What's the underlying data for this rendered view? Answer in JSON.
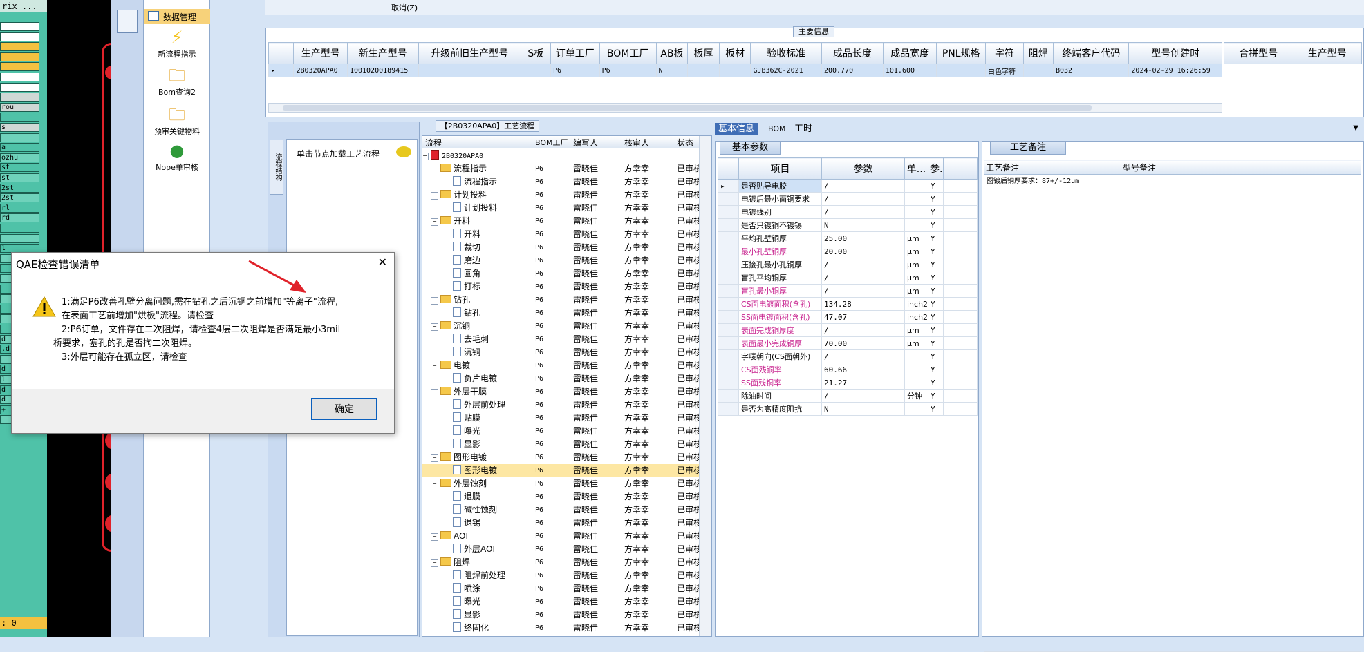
{
  "left_strip": {
    "title": "rix ...",
    "rows": [
      "",
      "",
      "",
      "",
      "",
      "",
      "",
      "",
      "rou",
      "",
      "s",
      "",
      "a",
      "ozhu",
      "st",
      "st",
      "2st",
      "2st",
      "rl",
      "rd",
      "",
      "",
      "l",
      "",
      "",
      "",
      "",
      "",
      "",
      "",
      "",
      "d",
      ".d",
      "",
      "d",
      "l",
      "d",
      "d",
      "+",
      ""
    ],
    "status": ": 0"
  },
  "nav": {
    "items": [
      {
        "label": "数据管理",
        "icon": "data-grid-icon"
      },
      {
        "label": "新流程指示",
        "icon": "lightning-icon"
      },
      {
        "label": "Bom查询2",
        "icon": "folder-icon"
      },
      {
        "label": "预审关键物料",
        "icon": "folder-icon"
      },
      {
        "label": "Nope单审核",
        "icon": "user-icon"
      }
    ]
  },
  "top_strip": {
    "cancel": "取消(Z)"
  },
  "main_info": {
    "title": "主要信息",
    "columns": [
      "生产型号",
      "新生产型号",
      "升级前旧生产型号",
      "S板",
      "订单工厂",
      "BOM工厂",
      "AB板",
      "板厚",
      "板材",
      "验收标准",
      "成品长度",
      "成品宽度",
      "PNL规格",
      "字符",
      "阻焊",
      "终端客户代码",
      "型号创建时"
    ],
    "row": [
      "2B0320APA0",
      "10010200189415",
      "",
      "",
      "P6",
      "P6",
      "N",
      "",
      "",
      "GJB362C-2021",
      "200.770",
      "101.600",
      "",
      "白色字符",
      "",
      "B032",
      "2024-02-29 16:26:59"
    ],
    "side_columns": [
      "合拼型号",
      "生产型号"
    ]
  },
  "flow": {
    "title": "【2B0320APA0】工艺流程",
    "hint": "单击节点加载工艺流程",
    "side_label": "流程结构",
    "columns": [
      "流程",
      "BOM工厂",
      "编写人",
      "核审人",
      "状态"
    ],
    "nodes": [
      {
        "level": 0,
        "type": "root",
        "name": "2B0320APA0",
        "factory": "",
        "writer": "",
        "reviewer": "",
        "status": ""
      },
      {
        "level": 1,
        "type": "folder",
        "name": "流程指示",
        "factory": "P6",
        "writer": "雷晓佳",
        "reviewer": "方幸幸",
        "status": "已审核"
      },
      {
        "level": 2,
        "type": "doc",
        "name": "流程指示",
        "factory": "P6",
        "writer": "雷晓佳",
        "reviewer": "方幸幸",
        "status": "已审核"
      },
      {
        "level": 1,
        "type": "folder",
        "name": "计划投料",
        "factory": "P6",
        "writer": "雷晓佳",
        "reviewer": "方幸幸",
        "status": "已审核"
      },
      {
        "level": 2,
        "type": "doc",
        "name": "计划投料",
        "factory": "P6",
        "writer": "雷晓佳",
        "reviewer": "方幸幸",
        "status": "已审核"
      },
      {
        "level": 1,
        "type": "folder",
        "name": "开料",
        "factory": "P6",
        "writer": "雷晓佳",
        "reviewer": "方幸幸",
        "status": "已审核"
      },
      {
        "level": 2,
        "type": "doc",
        "name": "开料",
        "factory": "P6",
        "writer": "雷晓佳",
        "reviewer": "方幸幸",
        "status": "已审核"
      },
      {
        "level": 2,
        "type": "doc",
        "name": "裁切",
        "factory": "P6",
        "writer": "雷晓佳",
        "reviewer": "方幸幸",
        "status": "已审核"
      },
      {
        "level": 2,
        "type": "doc",
        "name": "磨边",
        "factory": "P6",
        "writer": "雷晓佳",
        "reviewer": "方幸幸",
        "status": "已审核"
      },
      {
        "level": 2,
        "type": "doc",
        "name": "圆角",
        "factory": "P6",
        "writer": "雷晓佳",
        "reviewer": "方幸幸",
        "status": "已审核"
      },
      {
        "level": 2,
        "type": "doc",
        "name": "打标",
        "factory": "P6",
        "writer": "雷晓佳",
        "reviewer": "方幸幸",
        "status": "已审核"
      },
      {
        "level": 1,
        "type": "folder",
        "name": "钻孔",
        "factory": "P6",
        "writer": "雷晓佳",
        "reviewer": "方幸幸",
        "status": "已审核"
      },
      {
        "level": 2,
        "type": "doc",
        "name": "钻孔",
        "factory": "P6",
        "writer": "雷晓佳",
        "reviewer": "方幸幸",
        "status": "已审核"
      },
      {
        "level": 1,
        "type": "folder",
        "name": "沉铜",
        "factory": "P6",
        "writer": "雷晓佳",
        "reviewer": "方幸幸",
        "status": "已审核"
      },
      {
        "level": 2,
        "type": "doc",
        "name": "去毛刺",
        "factory": "P6",
        "writer": "雷晓佳",
        "reviewer": "方幸幸",
        "status": "已审核"
      },
      {
        "level": 2,
        "type": "doc",
        "name": "沉铜",
        "factory": "P6",
        "writer": "雷晓佳",
        "reviewer": "方幸幸",
        "status": "已审核"
      },
      {
        "level": 1,
        "type": "folder",
        "name": "电镀",
        "factory": "P6",
        "writer": "雷晓佳",
        "reviewer": "方幸幸",
        "status": "已审核"
      },
      {
        "level": 2,
        "type": "doc",
        "name": "负片电镀",
        "factory": "P6",
        "writer": "雷晓佳",
        "reviewer": "方幸幸",
        "status": "已审核"
      },
      {
        "level": 1,
        "type": "folder",
        "name": "外层干膜",
        "factory": "P6",
        "writer": "雷晓佳",
        "reviewer": "方幸幸",
        "status": "已审核"
      },
      {
        "level": 2,
        "type": "doc",
        "name": "外层前处理",
        "factory": "P6",
        "writer": "雷晓佳",
        "reviewer": "方幸幸",
        "status": "已审核"
      },
      {
        "level": 2,
        "type": "doc",
        "name": "贴膜",
        "factory": "P6",
        "writer": "雷晓佳",
        "reviewer": "方幸幸",
        "status": "已审核"
      },
      {
        "level": 2,
        "type": "doc",
        "name": "曝光",
        "factory": "P6",
        "writer": "雷晓佳",
        "reviewer": "方幸幸",
        "status": "已审核"
      },
      {
        "level": 2,
        "type": "doc",
        "name": "显影",
        "factory": "P6",
        "writer": "雷晓佳",
        "reviewer": "方幸幸",
        "status": "已审核"
      },
      {
        "level": 1,
        "type": "folder",
        "name": "图形电镀",
        "factory": "P6",
        "writer": "雷晓佳",
        "reviewer": "方幸幸",
        "status": "已审核"
      },
      {
        "level": 2,
        "type": "doc",
        "name": "图形电镀",
        "factory": "P6",
        "writer": "雷晓佳",
        "reviewer": "方幸幸",
        "status": "已审核",
        "selected": true
      },
      {
        "level": 1,
        "type": "folder",
        "name": "外层蚀刻",
        "factory": "P6",
        "writer": "雷晓佳",
        "reviewer": "方幸幸",
        "status": "已审核"
      },
      {
        "level": 2,
        "type": "doc",
        "name": "退膜",
        "factory": "P6",
        "writer": "雷晓佳",
        "reviewer": "方幸幸",
        "status": "已审核"
      },
      {
        "level": 2,
        "type": "doc",
        "name": "碱性蚀刻",
        "factory": "P6",
        "writer": "雷晓佳",
        "reviewer": "方幸幸",
        "status": "已审核"
      },
      {
        "level": 2,
        "type": "doc",
        "name": "退锡",
        "factory": "P6",
        "writer": "雷晓佳",
        "reviewer": "方幸幸",
        "status": "已审核"
      },
      {
        "level": 1,
        "type": "folder",
        "name": "AOI",
        "factory": "P6",
        "writer": "雷晓佳",
        "reviewer": "方幸幸",
        "status": "已审核"
      },
      {
        "level": 2,
        "type": "doc",
        "name": "外层AOI",
        "factory": "P6",
        "writer": "雷晓佳",
        "reviewer": "方幸幸",
        "status": "已审核"
      },
      {
        "level": 1,
        "type": "folder",
        "name": "阻焊",
        "factory": "P6",
        "writer": "雷晓佳",
        "reviewer": "方幸幸",
        "status": "已审核"
      },
      {
        "level": 2,
        "type": "doc",
        "name": "阻焊前处理",
        "factory": "P6",
        "writer": "雷晓佳",
        "reviewer": "方幸幸",
        "status": "已审核"
      },
      {
        "level": 2,
        "type": "doc",
        "name": "喷涂",
        "factory": "P6",
        "writer": "雷晓佳",
        "reviewer": "方幸幸",
        "status": "已审核"
      },
      {
        "level": 2,
        "type": "doc",
        "name": "曝光",
        "factory": "P6",
        "writer": "雷晓佳",
        "reviewer": "方幸幸",
        "status": "已审核"
      },
      {
        "level": 2,
        "type": "doc",
        "name": "显影",
        "factory": "P6",
        "writer": "雷晓佳",
        "reviewer": "方幸幸",
        "status": "已审核"
      },
      {
        "level": 2,
        "type": "doc",
        "name": "终固化",
        "factory": "P6",
        "writer": "雷晓佳",
        "reviewer": "方幸幸",
        "status": "已审核"
      }
    ]
  },
  "right_tabs": [
    "基本信息",
    "BOM",
    "工时"
  ],
  "basic": {
    "title": "基本参数",
    "columns": [
      "项目",
      "参数",
      "单...",
      "参..."
    ],
    "rows": [
      {
        "item": "是否贴导电胶",
        "value": "/",
        "unit": "",
        "flag": "Y",
        "highlight": false
      },
      {
        "item": "电镀后最小面铜要求",
        "value": "/",
        "unit": "",
        "flag": "Y",
        "highlight": false
      },
      {
        "item": "电镀线别",
        "value": "/",
        "unit": "",
        "flag": "Y",
        "highlight": false
      },
      {
        "item": "是否只镀铜不镀锡",
        "value": "N",
        "unit": "",
        "flag": "Y",
        "highlight": false
      },
      {
        "item": "平均孔壁铜厚",
        "value": "25.00",
        "unit": "μm",
        "flag": "Y",
        "highlight": false
      },
      {
        "item": "最小孔壁铜厚",
        "value": "20.00",
        "unit": "μm",
        "flag": "Y",
        "highlight": true
      },
      {
        "item": "压接孔最小孔铜厚",
        "value": "/",
        "unit": "μm",
        "flag": "Y",
        "highlight": false
      },
      {
        "item": "盲孔平均铜厚",
        "value": "/",
        "unit": "μm",
        "flag": "Y",
        "highlight": false
      },
      {
        "item": "盲孔最小铜厚",
        "value": "/",
        "unit": "μm",
        "flag": "Y",
        "highlight": true
      },
      {
        "item": "CS面电镀面积(含孔)",
        "value": "134.28",
        "unit": "inch2",
        "flag": "Y",
        "highlight": true
      },
      {
        "item": "SS面电镀面积(含孔)",
        "value": "47.07",
        "unit": "inch2",
        "flag": "Y",
        "highlight": true
      },
      {
        "item": "表面完成铜厚度",
        "value": "/",
        "unit": "μm",
        "flag": "Y",
        "highlight": true
      },
      {
        "item": "表面最小完成铜厚",
        "value": "70.00",
        "unit": "μm",
        "flag": "Y",
        "highlight": true
      },
      {
        "item": "字唛朝向(CS面朝外)",
        "value": "/",
        "unit": "",
        "flag": "Y",
        "highlight": false
      },
      {
        "item": "CS面残铜率",
        "value": "60.66",
        "unit": "",
        "flag": "Y",
        "highlight": true
      },
      {
        "item": "SS面残铜率",
        "value": "21.27",
        "unit": "",
        "flag": "Y",
        "highlight": true
      },
      {
        "item": "除油时间",
        "value": "/",
        "unit": "分钟",
        "flag": "Y",
        "highlight": false
      },
      {
        "item": "是否为高精度阻抗",
        "value": "N",
        "unit": "",
        "flag": "Y",
        "highlight": false
      }
    ]
  },
  "craft": {
    "title": "工艺备注",
    "columns": [
      "工艺备注",
      "型号备注"
    ],
    "note": "图镀后铜厚要求：87+/-12um"
  },
  "dialog": {
    "title": "QAE检查错误清单",
    "close": "✕",
    "lines": [
      "1:满足P6改善孔壁分离问题,需在钻孔之后沉铜之前增加\"等离子\"流程,",
      "在表面工艺前增加\"烘板\"流程。请检查",
      "2:P6订单，文件存在二次阻焊，请检查4层二次阻焊是否满足最小3mil",
      "桥要求，塞孔的孔是否掏二次阻焊。",
      "3:外层可能存在孤立区，请检查"
    ],
    "ok": "确定"
  },
  "colors": {
    "accent": "#0a5fbd",
    "highlight_text": "#c8238f",
    "selected_row": "#fde7a3",
    "pcb_red": "#e0222a",
    "teal": "#4fc2a8"
  }
}
